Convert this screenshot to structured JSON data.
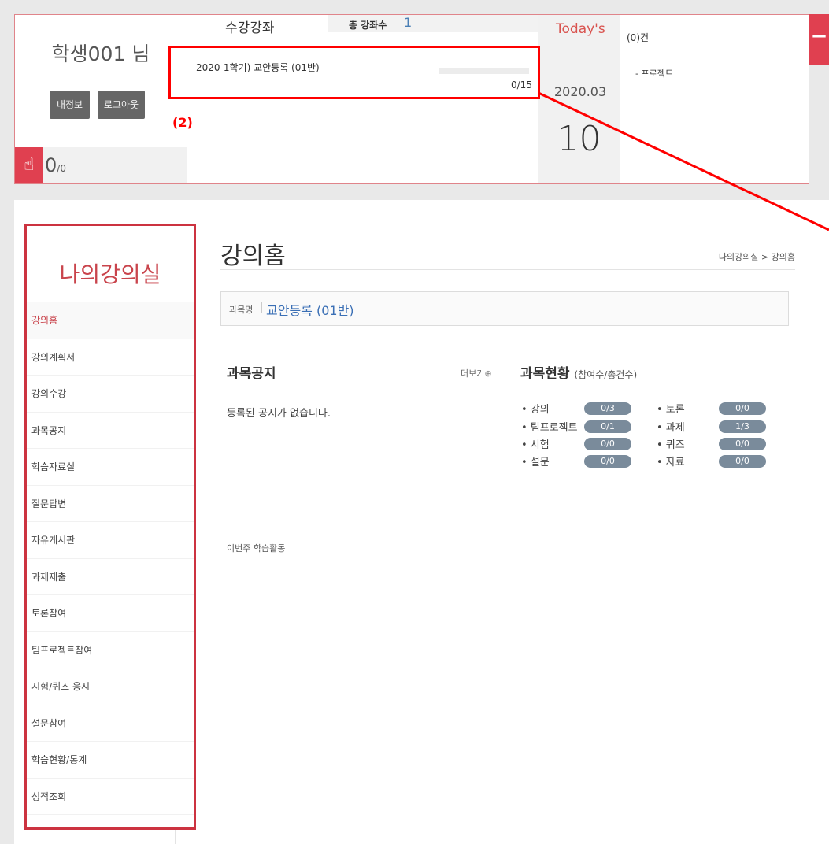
{
  "user": {
    "name": "학생001 님",
    "info_button": "내정보",
    "logout_button": "로그아웃",
    "points_value": "0",
    "points_total": "/0",
    "points_icon": "hand-pointer-icon"
  },
  "courses": {
    "title": "수강강좌",
    "total_label": "총 강좌수",
    "total_value": "1",
    "items": [
      {
        "name": "2020-1학기) 교안등록 (01반)",
        "progress": "0/15",
        "progress_fraction": 0
      }
    ]
  },
  "today": {
    "label": "Today's",
    "month": "2020.03",
    "day": "10"
  },
  "news": {
    "count": "(0)건",
    "item": "- 프로젝트"
  },
  "annotation": {
    "label": "(2)",
    "color": "#ff0000"
  },
  "sidebar": {
    "title": "나의강의실",
    "items": [
      {
        "label": "강의홈",
        "active": true
      },
      {
        "label": "강의계획서"
      },
      {
        "label": "강의수강"
      },
      {
        "label": "과목공지"
      },
      {
        "label": "학습자료실"
      },
      {
        "label": "질문답변"
      },
      {
        "label": "자유게시판"
      },
      {
        "label": "과제제출"
      },
      {
        "label": "토론참여"
      },
      {
        "label": "팀프로젝트참여"
      },
      {
        "label": "시험/퀴즈 응시"
      },
      {
        "label": "설문참여"
      },
      {
        "label": "학습현황/통계"
      },
      {
        "label": "성적조회"
      }
    ]
  },
  "main": {
    "page_title": "강의홈",
    "breadcrumb": "나의강의실 > 강의홈",
    "subject_label": "과목명",
    "subject_separator": "|",
    "subject_name": "교안등록 (01반)",
    "notice": {
      "title": "과목공지",
      "more": "더보기",
      "more_icon": "plus-circle-icon",
      "empty": "등록된 공지가 없습니다."
    },
    "status": {
      "title": "과목현황",
      "subtitle": "(참여수/총건수)",
      "items": [
        {
          "label": "• 강의",
          "value": "0/3"
        },
        {
          "label": "• 토론",
          "value": "0/0"
        },
        {
          "label": "• 팀프로젝트",
          "value": "0/1"
        },
        {
          "label": "• 과제",
          "value": "1/3"
        },
        {
          "label": "• 시험",
          "value": "0/0"
        },
        {
          "label": "• 퀴즈",
          "value": "0/0"
        },
        {
          "label": "• 설문",
          "value": "0/0"
        },
        {
          "label": "• 자료",
          "value": "0/0"
        }
      ]
    },
    "weekly_title": "이번주 학습활동"
  },
  "colors": {
    "accent": "#e04050",
    "link": "#3a6fb5",
    "pill": "#7a8b9b"
  }
}
